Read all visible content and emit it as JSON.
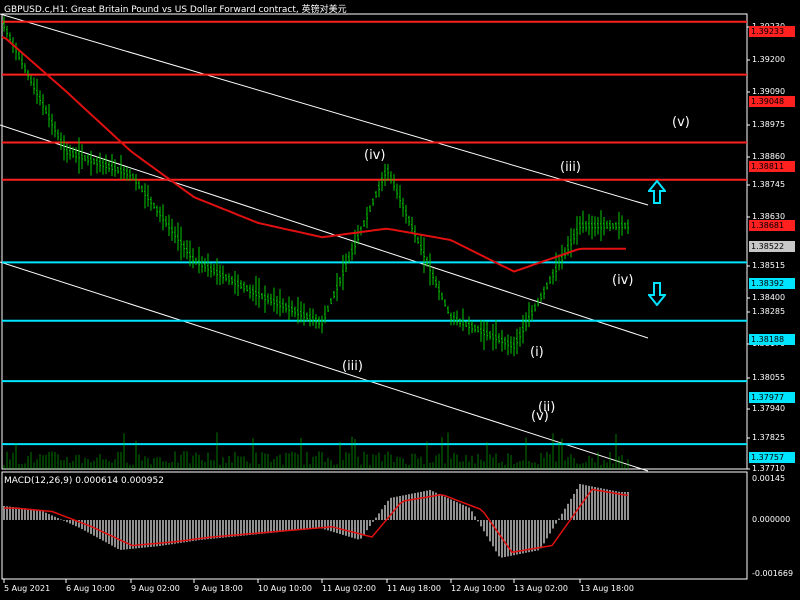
{
  "header": {
    "title": "GBPUSD.c,H1:  Great Britain Pound vs US Dollar Forward contract, 英镑对美元",
    "macd": "MACD(12,26,9) 0.000614 0.000952"
  },
  "price_axis": {
    "ticks": [
      "1.39230",
      "1.39200",
      "1.39090",
      "1.38975",
      "1.38860",
      "1.38745",
      "1.38630",
      "1.38515",
      "1.38400",
      "1.38285",
      "1.38170",
      "1.38055",
      "1.37940",
      "1.37825",
      "1.37710"
    ]
  },
  "price_labels": [
    {
      "text": "1.39233",
      "color": "#ff2020",
      "kind": "resistance"
    },
    {
      "text": "1.39048",
      "color": "#ff2020",
      "kind": "resistance"
    },
    {
      "text": "1.38811",
      "color": "#ff2020",
      "kind": "resistance"
    },
    {
      "text": "1.38681",
      "color": "#ff2020",
      "kind": "resistance"
    },
    {
      "text": "1.38522",
      "color": "#ffffff",
      "kind": "current"
    },
    {
      "text": "1.38392",
      "color": "#00e5ff",
      "kind": "support"
    },
    {
      "text": "1.38188",
      "color": "#00e5ff",
      "kind": "support"
    },
    {
      "text": "1.37977",
      "color": "#00e5ff",
      "kind": "support"
    },
    {
      "text": "1.37757",
      "color": "#00e5ff",
      "kind": "support"
    }
  ],
  "macd_axis": {
    "ticks": [
      "0.00145",
      "0.000000",
      "-0.001669"
    ]
  },
  "time_axis": {
    "labels": [
      "5 Aug 2021",
      "6 Aug 10:00",
      "9 Aug 02:00",
      "9 Aug 18:00",
      "10 Aug 10:00",
      "11 Aug 02:00",
      "11 Aug 18:00",
      "12 Aug 10:00",
      "13 Aug 02:00",
      "13 Aug 18:00"
    ]
  },
  "waves": [
    "(iv)",
    "(iii)",
    "(iii)",
    "(v)",
    "(iv)",
    "(ii)",
    "(i)",
    "(v)"
  ],
  "colors": {
    "background": "#000000",
    "candles": "#00c800",
    "ma": "#e01010",
    "resistance": "#ff2020",
    "support": "#00e5ff",
    "macd_hist": "#c0c0c0",
    "macd_signal": "#e01010",
    "channel": "#ffffff"
  },
  "icons": [
    "up-arrow-icon",
    "down-arrow-icon"
  ],
  "chart_data": {
    "type": "line",
    "symbol": "GBPUSD.c",
    "timeframe": "H1",
    "x": [
      "5 Aug 2021",
      "6 Aug 10:00",
      "9 Aug 02:00",
      "9 Aug 18:00",
      "10 Aug 10:00",
      "11 Aug 02:00",
      "11 Aug 18:00",
      "12 Aug 10:00",
      "13 Aug 02:00",
      "13 Aug 18:00"
    ],
    "series": [
      {
        "values": [
          1.3922,
          1.3878,
          1.387,
          1.384,
          1.3828,
          1.3818,
          1.3872,
          1.382,
          1.381,
          1.3852
        ]
      },
      {
        "values": [
          1.3918,
          1.3899,
          1.3878,
          1.3862,
          1.3853,
          1.3848,
          1.3851,
          1.3847,
          1.3836,
          1.3844
        ]
      }
    ],
    "horizontal_levels": [
      1.39233,
      1.39048,
      1.38811,
      1.38681,
      1.38392,
      1.38188,
      1.37977,
      1.37757
    ],
    "ylim": [
      1.3767,
      1.3926
    ]
  }
}
